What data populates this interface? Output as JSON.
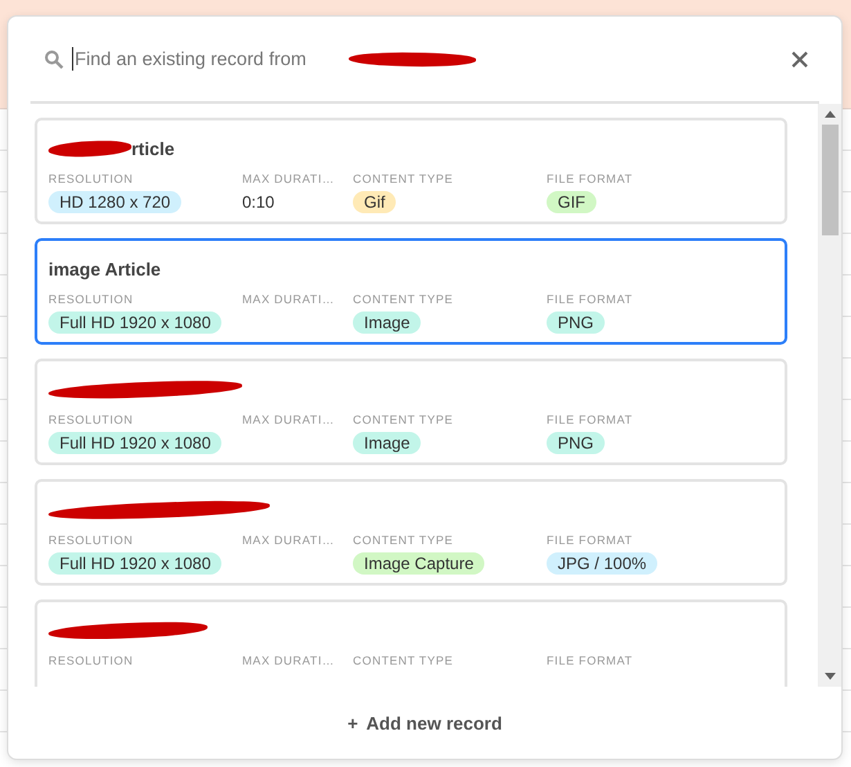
{
  "search": {
    "placeholder": "Find an existing record from",
    "redacted": true
  },
  "records": [
    {
      "selected": false,
      "redacted": true,
      "title": "rticle",
      "fields": [
        {
          "label": "RESOLUTION",
          "kind": "chip",
          "value": "HD 1280 x 720",
          "color": "#d0f0fd"
        },
        {
          "label": "MAX DURATI…",
          "kind": "text",
          "value": "0:10"
        },
        {
          "label": "CONTENT TYPE",
          "kind": "chip",
          "value": "Gif",
          "color": "#ffeab6"
        },
        {
          "label": "FILE FORMAT",
          "kind": "chip",
          "value": "GIF",
          "color": "#d1f7c4"
        }
      ]
    },
    {
      "selected": true,
      "redacted": false,
      "title": "image Article",
      "fields": [
        {
          "label": "RESOLUTION",
          "kind": "chip",
          "value": "Full HD 1920 x 1080",
          "color": "#c2f5e9"
        },
        {
          "label": "MAX DURATI…",
          "kind": "empty"
        },
        {
          "label": "CONTENT TYPE",
          "kind": "chip",
          "value": "Image",
          "color": "#c2f5e9"
        },
        {
          "label": "FILE FORMAT",
          "kind": "chip",
          "value": "PNG",
          "color": "#c2f5e9"
        }
      ]
    },
    {
      "selected": false,
      "redacted": true,
      "fields": [
        {
          "label": "RESOLUTION",
          "kind": "chip",
          "value": "Full HD 1920 x 1080",
          "color": "#c2f5e9"
        },
        {
          "label": "MAX DURATI…",
          "kind": "empty"
        },
        {
          "label": "CONTENT TYPE",
          "kind": "chip",
          "value": "Image",
          "color": "#c2f5e9"
        },
        {
          "label": "FILE FORMAT",
          "kind": "chip",
          "value": "PNG",
          "color": "#c2f5e9"
        }
      ]
    },
    {
      "selected": false,
      "redacted": true,
      "fields": [
        {
          "label": "RESOLUTION",
          "kind": "chip",
          "value": "Full HD 1920 x 1080",
          "color": "#c2f5e9"
        },
        {
          "label": "MAX DURATI…",
          "kind": "empty"
        },
        {
          "label": "CONTENT TYPE",
          "kind": "chip",
          "value": "Image Capture",
          "color": "#d1f7c4"
        },
        {
          "label": "FILE FORMAT",
          "kind": "chip",
          "value": "JPG / 100%",
          "color": "#d0f0fd"
        }
      ]
    },
    {
      "selected": false,
      "redacted": true,
      "fields": [
        {
          "label": "RESOLUTION",
          "kind": "empty"
        },
        {
          "label": "MAX DURATI…",
          "kind": "empty"
        },
        {
          "label": "CONTENT TYPE",
          "kind": "empty"
        },
        {
          "label": "FILE FORMAT",
          "kind": "empty"
        }
      ]
    }
  ],
  "footer": {
    "add_button": {
      "icon": "+",
      "label": "Add new record"
    }
  }
}
